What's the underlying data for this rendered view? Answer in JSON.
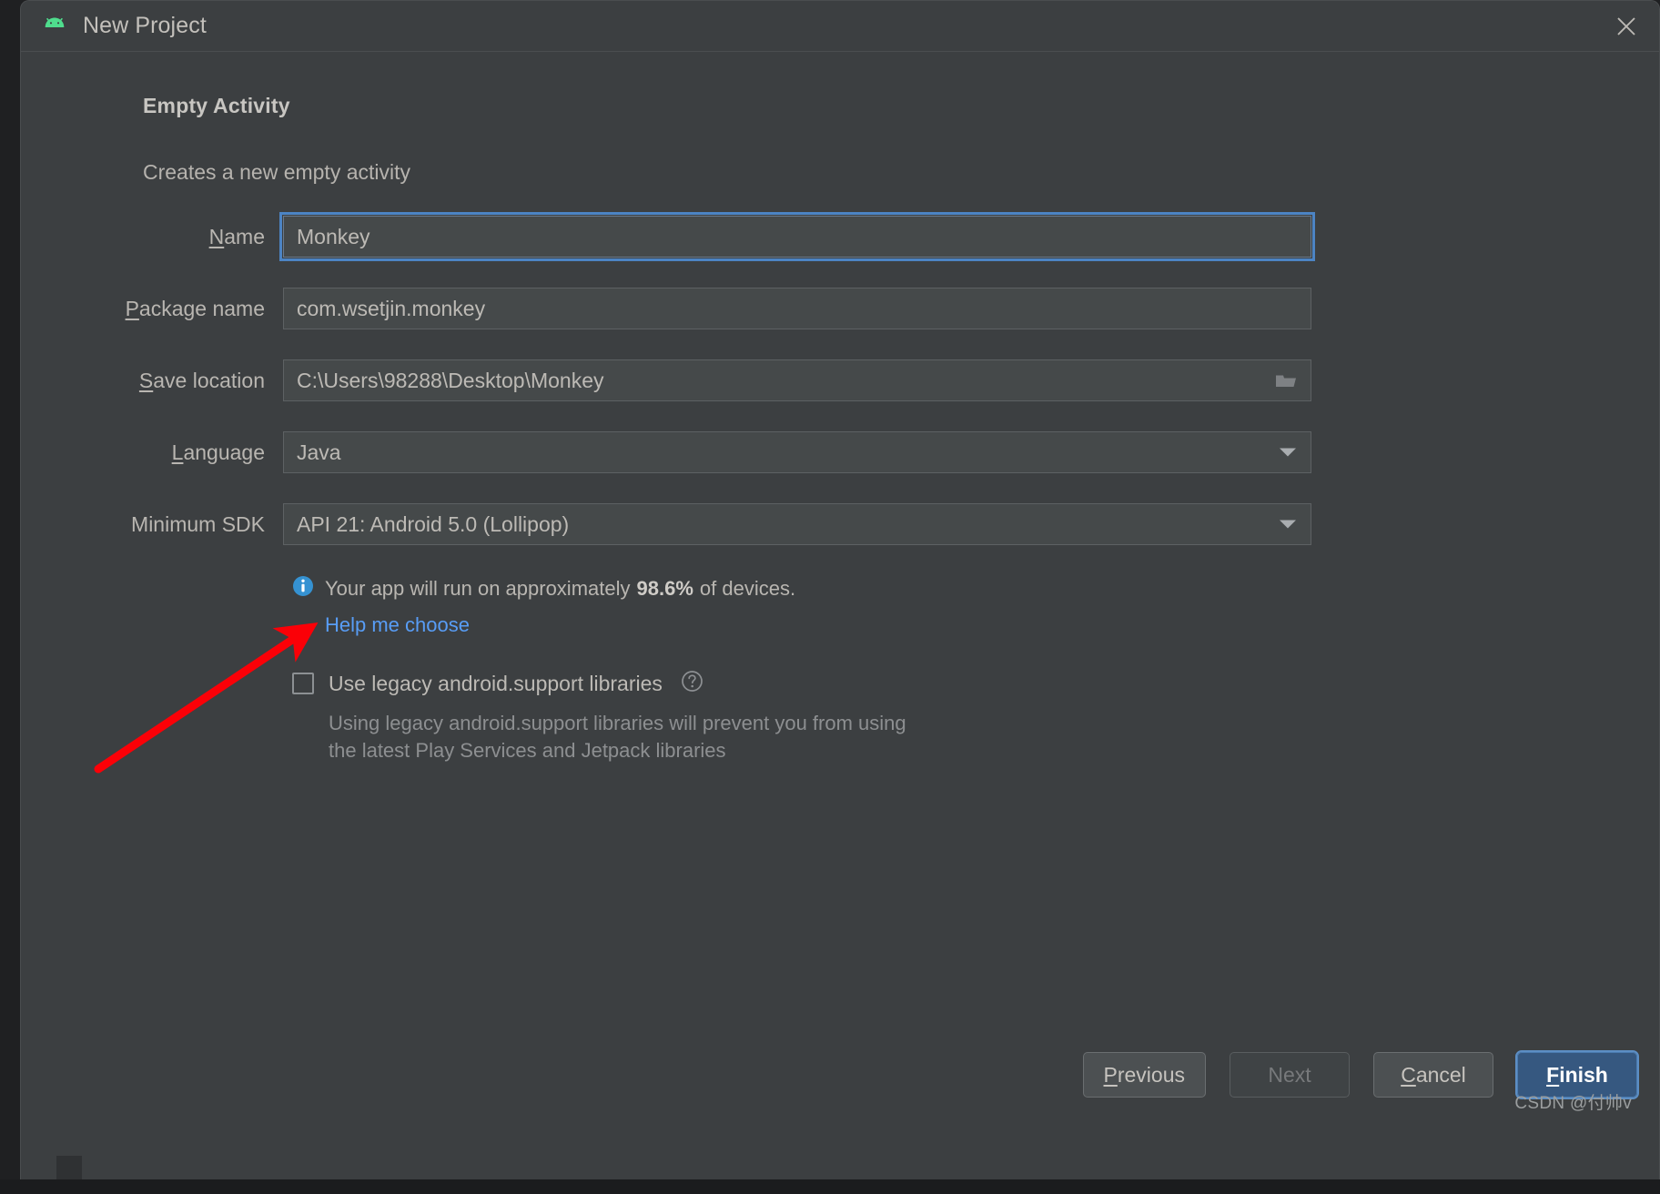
{
  "window": {
    "title": "New Project",
    "app_icon": "android-robot-icon",
    "close_icon": "close-icon"
  },
  "header": {
    "heading": "Empty Activity",
    "subheading": "Creates a new empty activity"
  },
  "form": {
    "fields": [
      {
        "label_prefix": "",
        "label_mnemonic": "N",
        "label_suffix": "ame",
        "value": "Monkey",
        "name": "name-field",
        "type": "text",
        "focused": true
      },
      {
        "label_prefix": "",
        "label_mnemonic": "P",
        "label_suffix": "ackage name",
        "value": "com.wsetjin.monkey",
        "name": "package-name-field",
        "type": "text",
        "focused": false
      },
      {
        "label_prefix": "",
        "label_mnemonic": "S",
        "label_suffix": "ave location",
        "value": "C:\\Users\\98288\\Desktop\\Monkey",
        "name": "save-location-field",
        "type": "text-with-browse",
        "focused": false
      },
      {
        "label_prefix": "",
        "label_mnemonic": "L",
        "label_suffix": "anguage",
        "value": "Java",
        "name": "language-dropdown",
        "type": "combo",
        "focused": false
      },
      {
        "label_prefix": "Minimum SDK",
        "label_mnemonic": "",
        "label_suffix": "",
        "value": "API 21: Android 5.0 (Lollipop)",
        "name": "minimum-sdk-dropdown",
        "type": "combo",
        "focused": false
      }
    ]
  },
  "info": {
    "icon": "info-icon",
    "text_before": "Your app will run on approximately",
    "percent": "98.6%",
    "text_after": "of devices.",
    "link": "Help me choose"
  },
  "legacy": {
    "checkbox_label": "Use legacy android.support libraries",
    "checked": false,
    "help_icon": "help-circle-icon",
    "description_line1": "Using legacy android.support libraries will prevent you from using",
    "description_line2": "the latest Play Services and Jetpack libraries"
  },
  "footer": {
    "previous": {
      "prefix": "",
      "mnemonic": "P",
      "suffix": "revious",
      "enabled": true
    },
    "next": {
      "prefix": "Next",
      "mnemonic": "",
      "suffix": "",
      "enabled": false
    },
    "cancel": {
      "prefix": "",
      "mnemonic": "C",
      "suffix": "ancel",
      "enabled": true
    },
    "finish": {
      "prefix": "",
      "mnemonic": "F",
      "suffix": "inish",
      "enabled": true,
      "primary": true
    }
  },
  "watermark": "CSDN @付帅v",
  "annotation": {
    "arrow_color": "#fb0007",
    "points_at": "minimum-sdk-dropdown"
  },
  "colors": {
    "dialog_bg": "#3c3f41",
    "field_bg": "#45494a",
    "accent_blue": "#4c84c4",
    "link_blue": "#589df6",
    "primary_button": "#365880",
    "android_green": "#4fdd8d"
  }
}
